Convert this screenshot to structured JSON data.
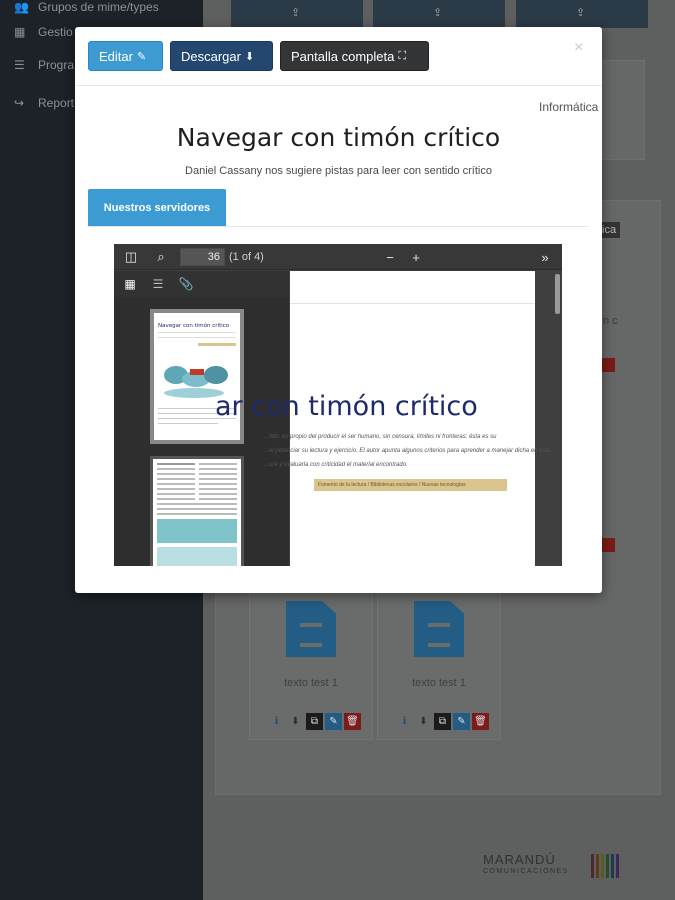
{
  "sidebar": {
    "items": [
      {
        "label": "Grupos de mime/types",
        "icon": "users-icon"
      },
      {
        "label": "Gestio",
        "icon": "table-icon"
      },
      {
        "label": "Progra",
        "icon": "list-icon"
      },
      {
        "label": "Report",
        "icon": "share-icon"
      }
    ]
  },
  "background": {
    "cards": [
      {
        "label": "texto test 1"
      },
      {
        "label": "texto test 1"
      }
    ],
    "peek_right_1": "tica",
    "peek_right_2": "n c",
    "logo": {
      "name": "MARANDÚ",
      "tagline": "COMUNICACIONES"
    }
  },
  "modal": {
    "buttons": {
      "edit": "Editar",
      "download": "Descargar",
      "fullscreen": "Pantalla completa"
    },
    "close": "×",
    "category": "Informática",
    "title": "Navegar con timón crítico",
    "subtitle": "Daniel Cassany nos sugiere pistas para leer con sentido crítico",
    "tab": "Nuestros servidores",
    "viewer": {
      "page_value": "36",
      "page_count": "(1 of 4)",
      "page_title": "ar con timón crítico",
      "thumb_title": "Navegar con timón crítico",
      "text_line1": "...tido.  es propio del producir el ser humano, sin censura, límites ni fronteras: ésta es su",
      "text_line2": "...el potenciar su lectura y ejercicio. El autor apunta algunos criterios para aprender a manejar dicha en esta",
      "text_line3": "...ura y evaluarla con criticidad el material encontrado.",
      "reference": "Fomento de la lectura / Bibliotecas escolares / Nuevas tecnologías"
    }
  },
  "colors": {
    "primary": "#3d9bd2",
    "download": "#24476f",
    "fullscreen": "#333537",
    "title_blue": "#1e2a6b"
  }
}
